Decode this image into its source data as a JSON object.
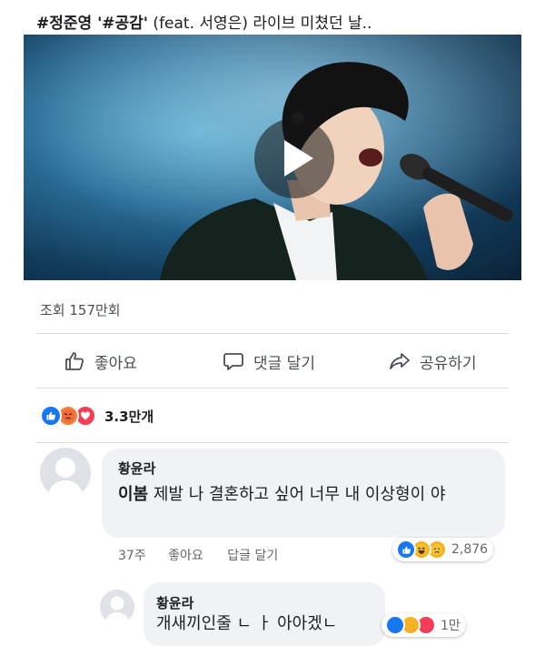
{
  "post": {
    "title_tags": "#정준영 '#공감'",
    "title_rest": " (feat. 서영은) 라이브 미쳤던 날..",
    "views": "조회 157만회"
  },
  "actions": {
    "like": "좋아요",
    "comment": "댓글 달기",
    "share": "공유하기"
  },
  "reactions": {
    "count": "3.3만개",
    "types": [
      "like-icon",
      "angry-icon",
      "love-icon"
    ]
  },
  "comments": [
    {
      "author": "황윤라",
      "text_bold": "이봄",
      "text": " 제발 나 결혼하고 싶어 너무 내 이상형이 야",
      "time": "37주",
      "like": "좋아요",
      "reply": "답글 달기",
      "reaction_count": "2,876",
      "reaction_types": [
        "like-icon",
        "haha-icon",
        "sad-icon"
      ]
    },
    {
      "author": "황윤라",
      "text_partial": "개새끼인줄 ㄴ ㅏ 아아겠ㄴ",
      "reaction_count": "1만"
    }
  ],
  "colors": {
    "like_blue": "#1877f2",
    "angry_orange": "#f0813a",
    "love_red": "#f33e58",
    "bubble_gray": "#f0f2f5"
  }
}
